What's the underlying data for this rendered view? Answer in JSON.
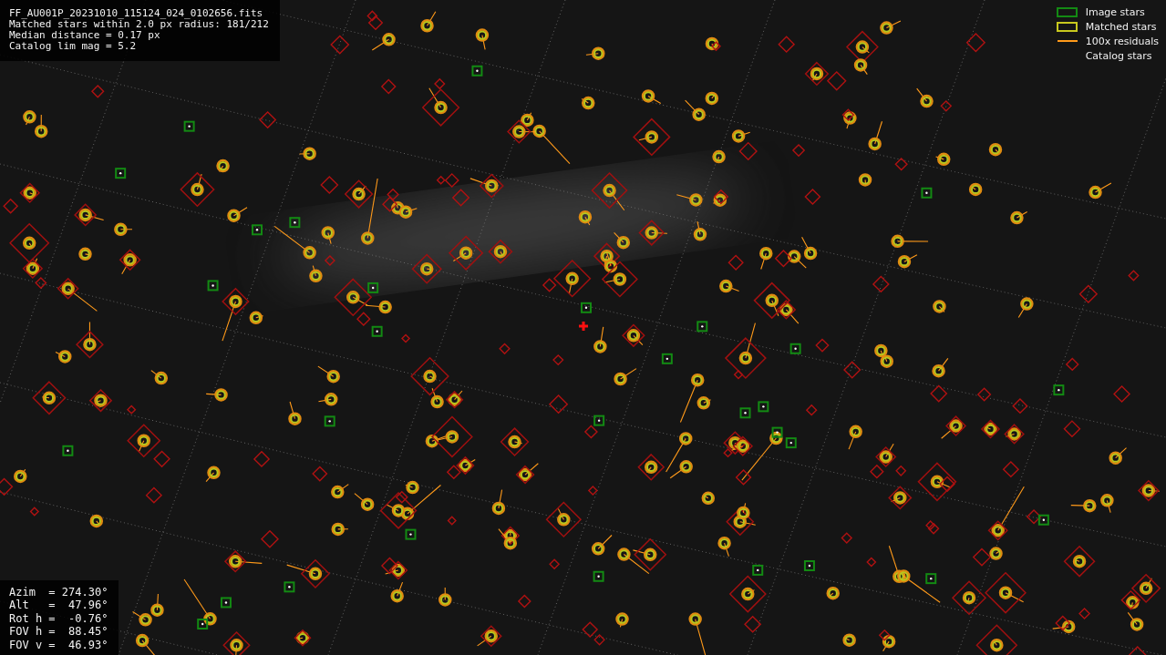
{
  "file_info": {
    "lines": [
      "FF_AU001P_20231010_115124_024_0102656.fits",
      "Matched stars within 2.0 px radius: 181/212",
      "Median distance = 0.17 px",
      "Catalog lim mag = 5.2"
    ]
  },
  "legend": [
    {
      "kind": "box",
      "color": "#138a13",
      "label": "Image stars"
    },
    {
      "kind": "box",
      "color": "#c8c81e",
      "label": "Matched stars"
    },
    {
      "kind": "line",
      "color": "#ff9a1a",
      "label": "100x residuals"
    },
    {
      "kind": "none",
      "label": "Catalog stars"
    }
  ],
  "pointing": {
    "lines": [
      "Azim  = 274.30°",
      "Alt   =  47.96°",
      "Rot h =  -0.76°",
      "FOV h =  88.45°",
      "FOV v =  46.93°"
    ]
  }
}
